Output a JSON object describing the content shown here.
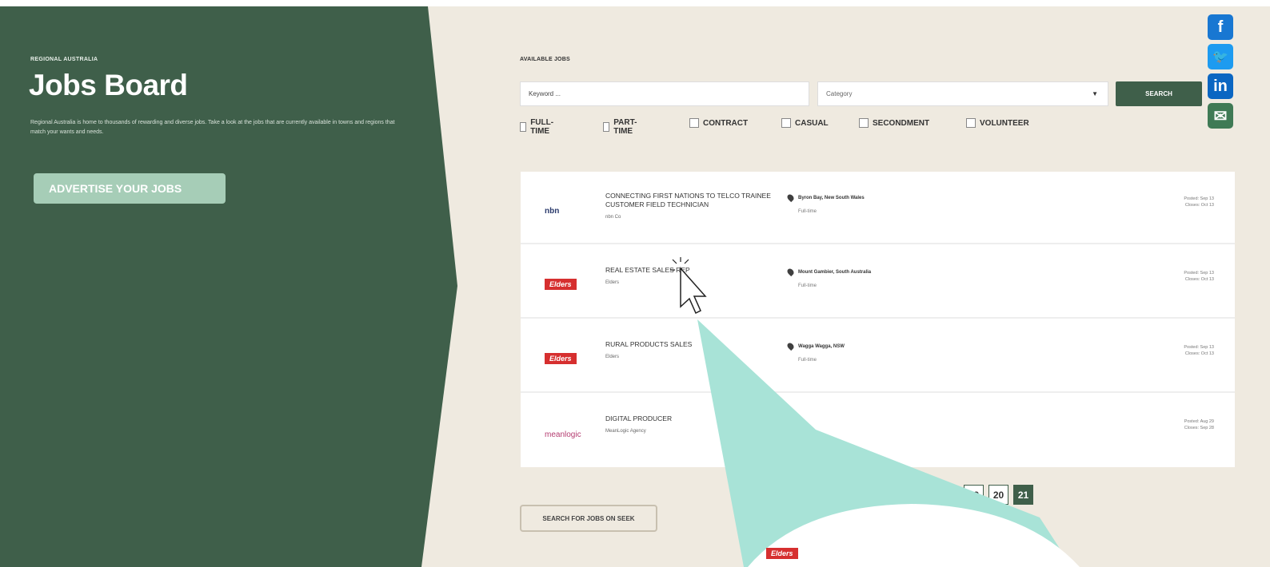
{
  "header": {
    "eyebrow": "REGIONAL AUSTRALIA",
    "title": "Jobs Board",
    "intro": "Regional Australia is home to thousands of rewarding and diverse jobs. Take a look at the jobs that are currently available in towns and regions that match your wants and needs.",
    "advertise_label": "ADVERTISE YOUR JOBS"
  },
  "search": {
    "section_label": "AVAILABLE JOBS",
    "keyword_placeholder": "Keyword ...",
    "category_placeholder": "Category",
    "search_label": "SEARCH"
  },
  "filters": [
    "FULL-TIME",
    "PART-TIME",
    "CONTRACT",
    "CASUAL",
    "SECONDMENT",
    "VOLUNTEER"
  ],
  "social": [
    {
      "icon": "facebook-icon",
      "glyph": "f",
      "color": "#1877d2"
    },
    {
      "icon": "twitter-icon",
      "glyph": "🐦",
      "color": "#1d9bf0"
    },
    {
      "icon": "linkedin-icon",
      "glyph": "in",
      "color": "#0a66c2"
    },
    {
      "icon": "email-icon",
      "glyph": "✉",
      "color": "#3f7a55"
    }
  ],
  "jobs": [
    {
      "logo": "nbn",
      "logo_text": "nbn",
      "title": "CONNECTING FIRST NATIONS TO TELCO TRAINEE CUSTOMER FIELD TECHNICIAN",
      "company": "nbn Co",
      "location": "Byron Bay, New South Wales",
      "type": "Full-time",
      "posted": "Posted: Sep 13",
      "closes": "Closes: Oct 13"
    },
    {
      "logo": "elders",
      "logo_text": "Elders",
      "title": "REAL ESTATE SALES REP",
      "company": "Elders",
      "location": "Mount Gambier, South Australia",
      "type": "Full-time",
      "posted": "Posted: Sep 13",
      "closes": "Closes: Oct 13"
    },
    {
      "logo": "elders",
      "logo_text": "Elders",
      "title": "RURAL PRODUCTS SALES",
      "company": "Elders",
      "location": "Wagga Wagga, NSW",
      "type": "Full-time",
      "posted": "Posted: Sep 13",
      "closes": "Closes: Oct 13"
    },
    {
      "logo": "ml",
      "logo_text": "meanlogic",
      "title": "DIGITAL PRODUCER",
      "company": "MeanLogic Agency",
      "location": "",
      "type": "",
      "posted": "Posted: Aug 29",
      "closes": "Closes: Sep 28"
    }
  ],
  "pagination": {
    "pages": [
      "19",
      "20",
      "21"
    ],
    "active": "21"
  },
  "seek_label": "SEARCH FOR JOBS ON SEEK",
  "colors": {
    "brand_green": "#3f5f4a",
    "accent_mint": "#a6cdb7",
    "overlay_mint": "#a8e3d7",
    "elders_red": "#d62f2f"
  }
}
